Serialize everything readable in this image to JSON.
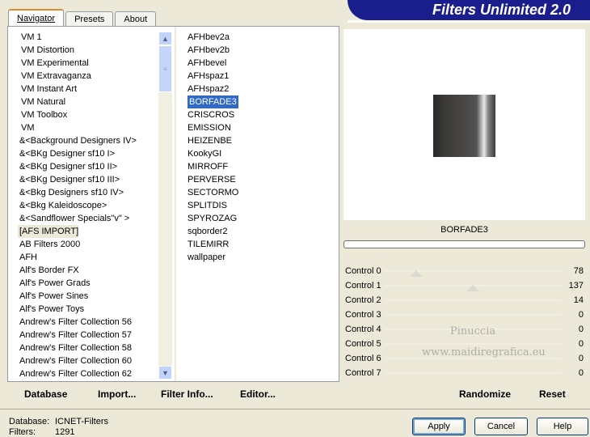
{
  "tabs": [
    "Navigator",
    "Presets",
    "About"
  ],
  "banner": "Filters Unlimited 2.0",
  "categories": [
    "VM 1",
    "VM Distortion",
    "VM Experimental",
    "VM Extravaganza",
    "VM Instant Art",
    "VM Natural",
    "VM Toolbox",
    "VM",
    "&<Background Designers IV>",
    "&<BKg Designer sf10 I>",
    "&<BKg Designer sf10 II>",
    "&<BKg Designer sf10 III>",
    "&<Bkg Designers sf10 IV>",
    "&<Bkg Kaleidoscope>",
    "&<Sandflower Specials\"v\" >",
    "[AFS IMPORT]",
    "AB Filters 2000",
    "AFH",
    "Alf's Border FX",
    "Alf's Power Grads",
    "Alf's Power Sines",
    "Alf's Power Toys",
    "Andrew's Filter Collection 56",
    "Andrew's Filter Collection 57",
    "Andrew's Filter Collection 58",
    "Andrew's Filter Collection 60",
    "Andrew's Filter Collection 62"
  ],
  "filters": [
    "AFHbev2a",
    "AFHbev2b",
    "AFHbevel",
    "AFHspaz1",
    "AFHspaz2",
    "BORFADE3",
    "CRISCROS",
    "EMISSION",
    "HEIZENBE",
    "KookyGI",
    "MIRROFF",
    "PERVERSE",
    "SECTORMO",
    "SPLITDIS",
    "SPYROZAG",
    "sqborder2",
    "TILEMIRR",
    "wallpaper"
  ],
  "selected_filter": "BORFADE3",
  "bottom_links": {
    "database": "Database",
    "import": "Import...",
    "filter_info": "Filter Info...",
    "editor": "Editor..."
  },
  "filter_name": "BORFADE3",
  "controls": [
    {
      "label": "Control 0",
      "value": "78"
    },
    {
      "label": "Control 1",
      "value": "137"
    },
    {
      "label": "Control 2",
      "value": "14"
    },
    {
      "label": "Control 3",
      "value": "0"
    },
    {
      "label": "Control 4",
      "value": "0"
    },
    {
      "label": "Control 5",
      "value": "0"
    },
    {
      "label": "Control 6",
      "value": "0"
    },
    {
      "label": "Control 7",
      "value": "0"
    }
  ],
  "watermark": {
    "line1": "Pinuccia",
    "line2": "www.maidiregrafica.eu"
  },
  "randomize": "Randomize",
  "reset": "Reset",
  "status": {
    "database_label": "Database:",
    "database_value": "ICNET-Filters",
    "filters_label": "Filters:",
    "filters_value": "1291"
  },
  "buttons": {
    "apply": "Apply",
    "cancel": "Cancel",
    "help": "Help"
  }
}
